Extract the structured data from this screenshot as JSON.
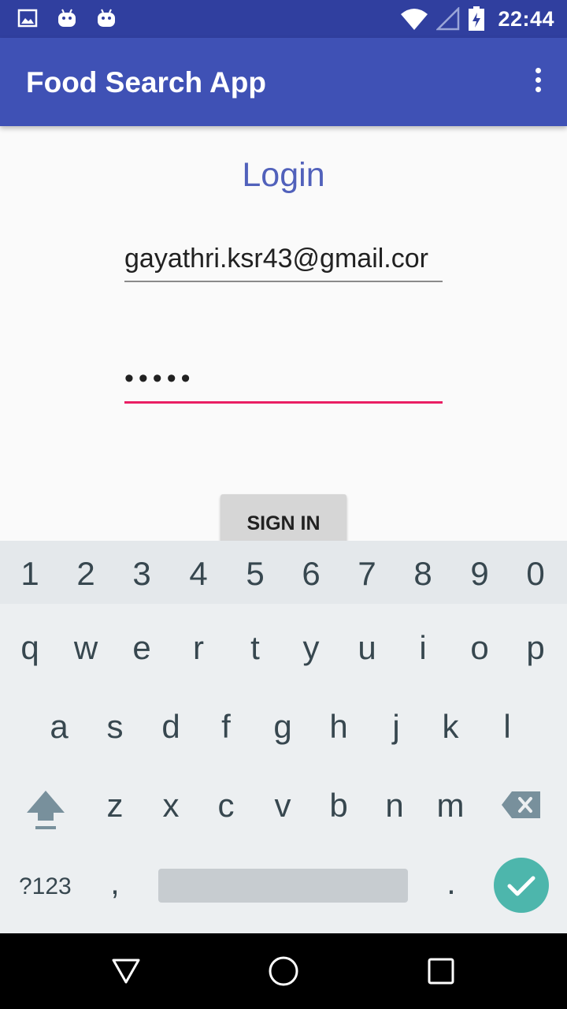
{
  "status_bar": {
    "time": "22:44",
    "icons": [
      "image-notification-icon",
      "android-notification-icon",
      "android-notification-icon",
      "wifi-icon",
      "signal-icon",
      "battery-icon"
    ]
  },
  "app_bar": {
    "title": "Food Search App",
    "menu_icon": "overflow-menu-icon"
  },
  "login": {
    "title": "Login",
    "email_value": "gayathri.ksr43@gmail.cor",
    "password_mask": "•••••",
    "sign_in_label": "SIGN IN"
  },
  "keyboard": {
    "numbers": [
      "1",
      "2",
      "3",
      "4",
      "5",
      "6",
      "7",
      "8",
      "9",
      "0"
    ],
    "row1": [
      "q",
      "w",
      "e",
      "r",
      "t",
      "y",
      "u",
      "i",
      "o",
      "p"
    ],
    "row2": [
      "a",
      "s",
      "d",
      "f",
      "g",
      "h",
      "j",
      "k",
      "l"
    ],
    "row3": [
      "z",
      "x",
      "c",
      "v",
      "b",
      "n",
      "m"
    ],
    "symbols_label": "?123",
    "comma": ",",
    "period": ".",
    "shift_icon": "shift-icon",
    "backspace_icon": "backspace-icon",
    "enter_icon": "checkmark-icon"
  },
  "colors": {
    "status_bar": "#303f9f",
    "app_bar": "#3f51b5",
    "accent": "#e91e63",
    "enter_key": "#4db6ac"
  },
  "nav_bar": {
    "icons": [
      "back-icon",
      "home-icon",
      "recents-icon"
    ]
  }
}
